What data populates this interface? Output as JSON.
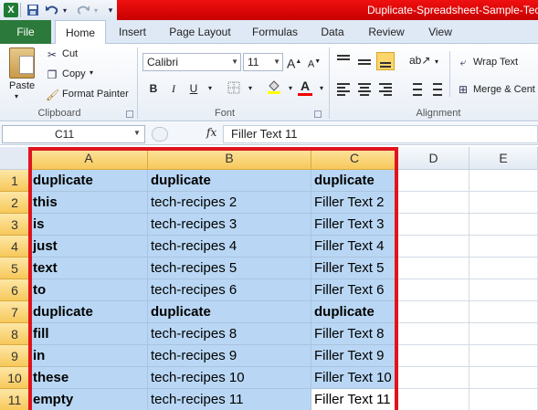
{
  "window": {
    "title": "Duplicate-Spreadsheet-Sample-Tec"
  },
  "qat": {
    "logo": "X",
    "save_icon": "save-icon",
    "undo_icon": "undo-icon",
    "redo_icon": "redo-icon"
  },
  "tabs": [
    {
      "label": "File"
    },
    {
      "label": "Home"
    },
    {
      "label": "Insert"
    },
    {
      "label": "Page Layout"
    },
    {
      "label": "Formulas"
    },
    {
      "label": "Data"
    },
    {
      "label": "Review"
    },
    {
      "label": "View"
    }
  ],
  "ribbon": {
    "clipboard": {
      "paste": "Paste",
      "cut": "Cut",
      "copy": "Copy",
      "format_painter": "Format Painter",
      "group": "Clipboard"
    },
    "font": {
      "name": "Calibri",
      "size": "11",
      "bold": "B",
      "italic": "I",
      "underline": "U",
      "font_color_letter": "A",
      "group": "Font"
    },
    "alignment": {
      "wrap_text": "Wrap Text",
      "merge": "Merge & Cent",
      "group": "Alignment"
    }
  },
  "formula_bar": {
    "name_box": "C11",
    "fx": "fx",
    "value": "Filler Text 11"
  },
  "columns": [
    "A",
    "B",
    "C",
    "D",
    "E"
  ],
  "rows": [
    {
      "num": "1",
      "a": "duplicate",
      "b": "duplicate",
      "c": "duplicate",
      "bold": true
    },
    {
      "num": "2",
      "a": "this",
      "b": "tech-recipes 2",
      "c": "Filler Text 2",
      "bold": false
    },
    {
      "num": "3",
      "a": "is",
      "b": "tech-recipes  3",
      "c": "Filler Text 3",
      "bold": false
    },
    {
      "num": "4",
      "a": "just",
      "b": "tech-recipes 4",
      "c": "Filler Text 4",
      "bold": false
    },
    {
      "num": "5",
      "a": "text",
      "b": "tech-recipes  5",
      "c": "Filler Text 5",
      "bold": false
    },
    {
      "num": "6",
      "a": "to",
      "b": "tech-recipes  6",
      "c": "Filler Text 6",
      "bold": false
    },
    {
      "num": "7",
      "a": "duplicate",
      "b": "duplicate",
      "c": "duplicate",
      "bold": true
    },
    {
      "num": "8",
      "a": "fill",
      "b": "tech-recipes  8",
      "c": "Filler Text 8",
      "bold": false
    },
    {
      "num": "9",
      "a": "in",
      "b": "tech-recipes 9",
      "c": "Filler Text 9",
      "bold": false
    },
    {
      "num": "10",
      "a": "these",
      "b": "tech-recipes  10",
      "c": "Filler Text 10",
      "bold": false
    },
    {
      "num": "11",
      "a": "empty",
      "b": "tech-recipes  11",
      "c": "Filler Text 11",
      "bold": false
    }
  ],
  "colors": {
    "selection_border": "#e0141e",
    "selection_fill": "#b9d7f4",
    "file_tab": "#2c7a3b"
  }
}
